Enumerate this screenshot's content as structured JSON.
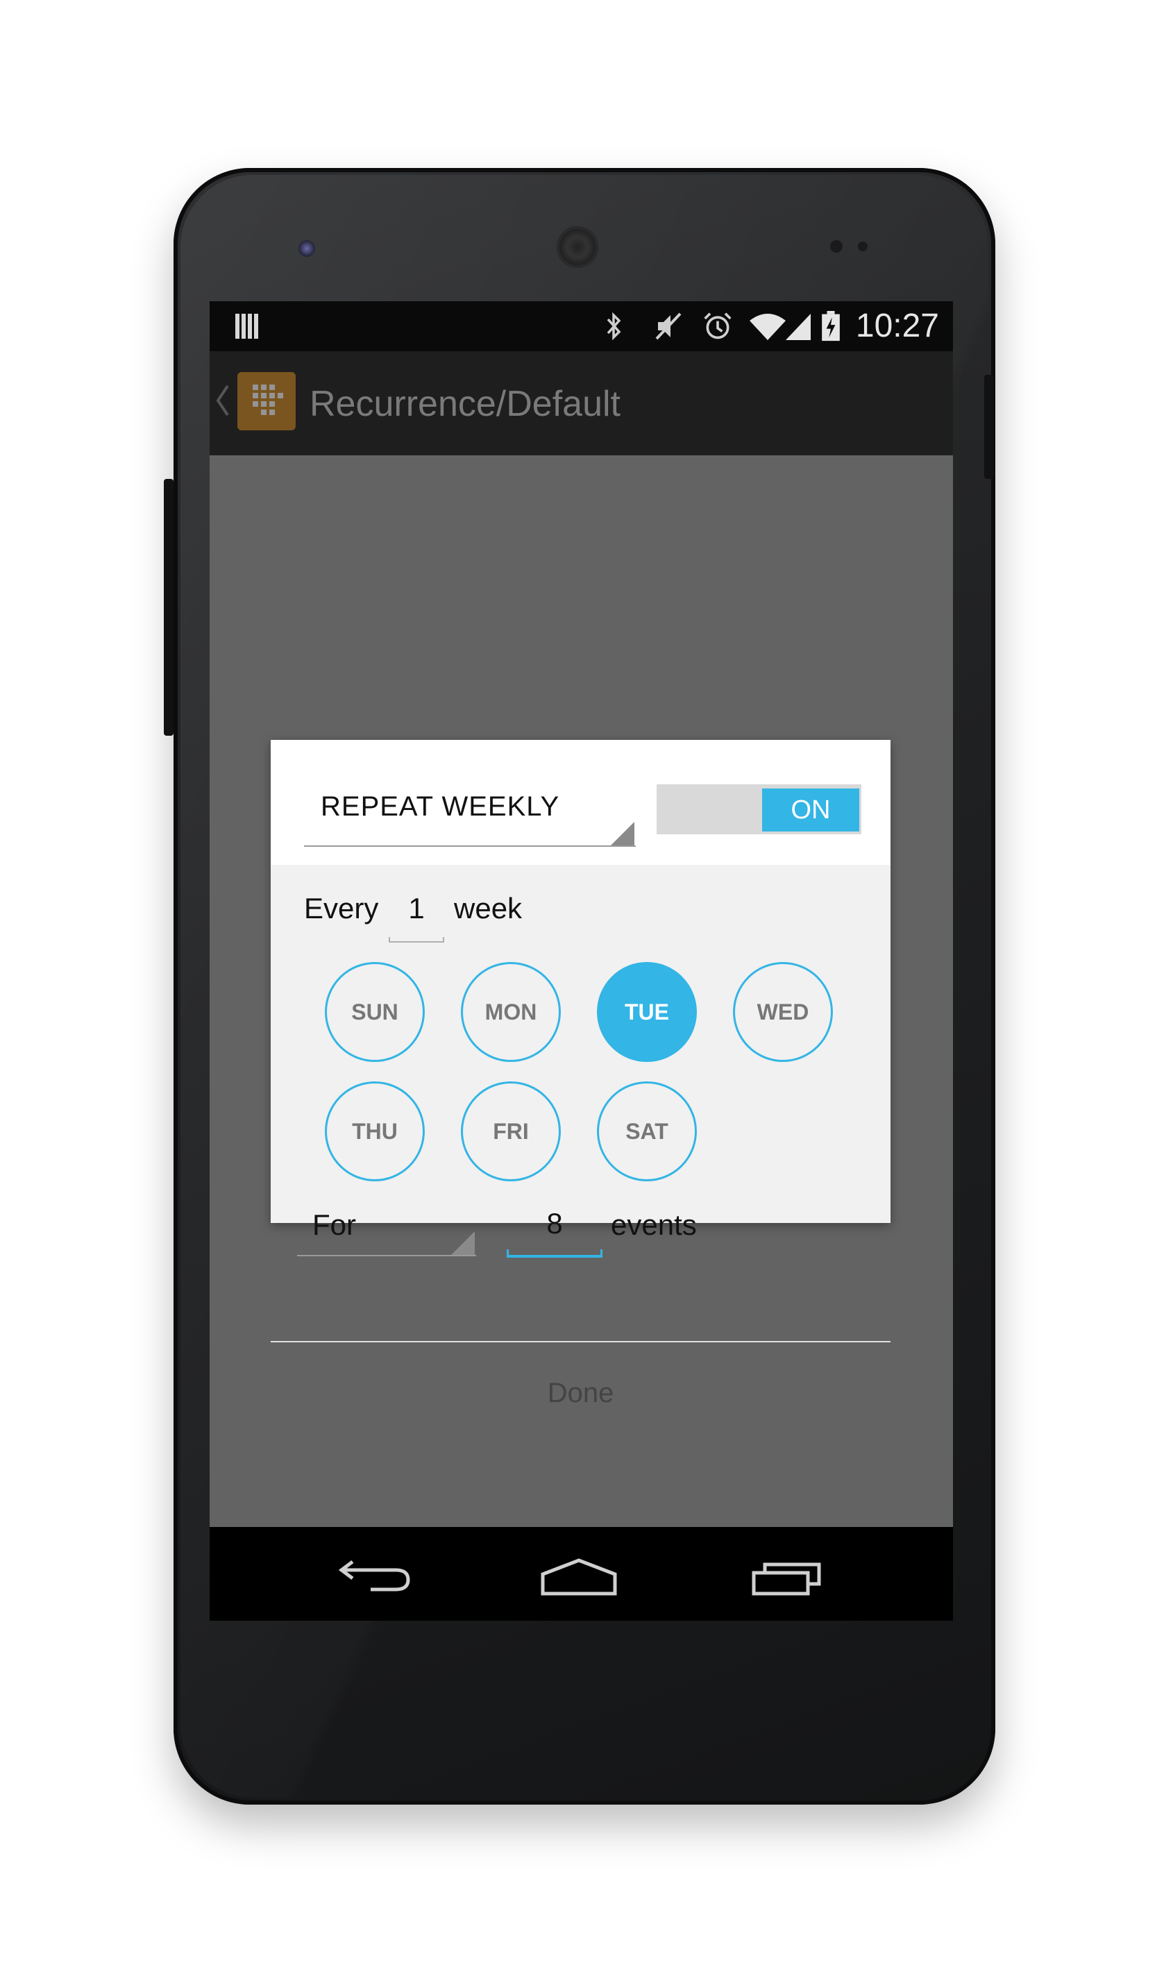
{
  "status_bar": {
    "time": "10:27",
    "icons": [
      "notification-bars-icon",
      "bluetooth-icon",
      "mute-icon",
      "alarm-icon",
      "wifi-icon",
      "signal-icon",
      "battery-charging-icon"
    ]
  },
  "action_bar": {
    "title": "Recurrence/Default",
    "icons": [
      "back-chevron-icon",
      "app-icon"
    ]
  },
  "dialog": {
    "frequency": "REPEAT WEEKLY",
    "toggle_label": "ON",
    "every_prefix": "Every",
    "interval": "1",
    "interval_unit": "week",
    "days": [
      {
        "label": "SUN",
        "selected": false
      },
      {
        "label": "MON",
        "selected": false
      },
      {
        "label": "TUE",
        "selected": true
      },
      {
        "label": "WED",
        "selected": false
      },
      {
        "label": "THU",
        "selected": false
      },
      {
        "label": "FRI",
        "selected": false
      },
      {
        "label": "SAT",
        "selected": false
      }
    ],
    "end_mode": "For",
    "count": "8",
    "count_unit": "events",
    "done_label": "Done"
  },
  "nav_bar": {
    "icons": [
      "back-icon",
      "home-icon",
      "recents-icon"
    ]
  },
  "colors": {
    "accent": "#33b5e5",
    "scrim": "#636363",
    "dialog_bg": "#f1f1f1"
  }
}
